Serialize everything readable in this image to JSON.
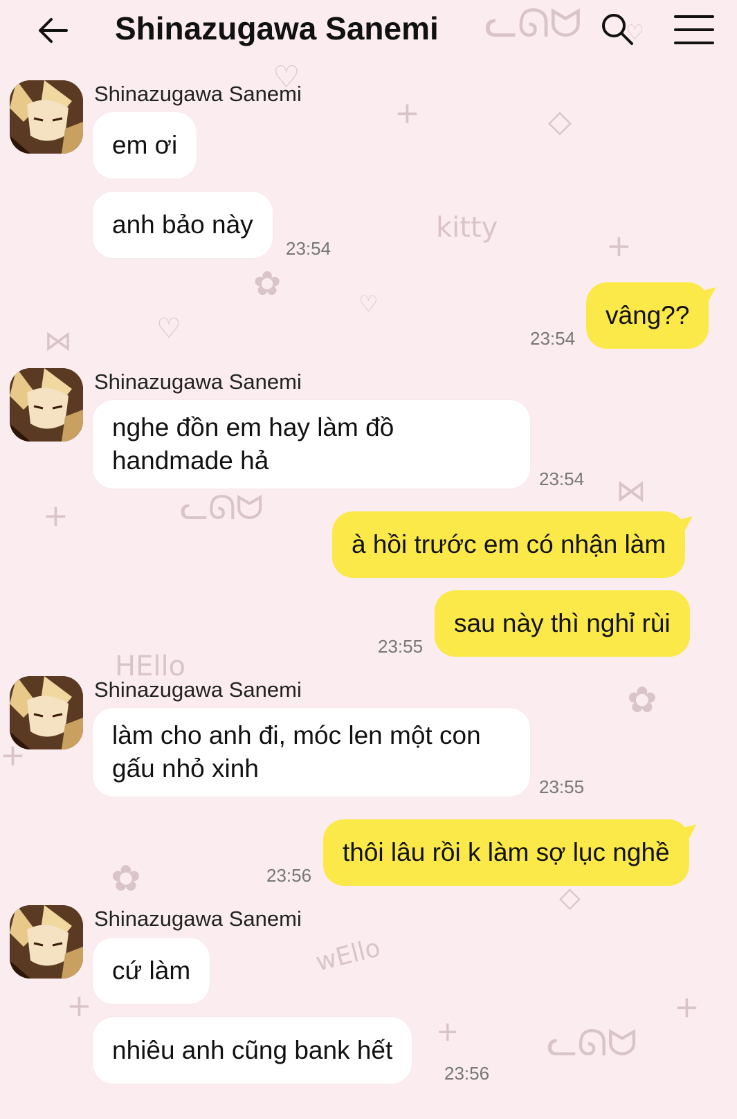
{
  "header": {
    "title": "Shinazugawa Sanemi"
  },
  "messages": [
    {
      "dir": "in",
      "sender": "Shinazugawa Sanemi",
      "text": "em ơi"
    },
    {
      "dir": "in",
      "text": "anh bảo này",
      "time": "23:54"
    },
    {
      "dir": "out",
      "text": "vâng??",
      "time": "23:54"
    },
    {
      "dir": "in",
      "sender": "Shinazugawa Sanemi",
      "text": "nghe đồn em hay làm đồ handmade hả",
      "time": "23:54"
    },
    {
      "dir": "out",
      "text": "à hồi trước em có nhận làm"
    },
    {
      "dir": "out",
      "text": "sau này thì nghỉ rùi",
      "time": "23:55"
    },
    {
      "dir": "in",
      "sender": "Shinazugawa Sanemi",
      "text": "làm cho anh đi, móc len một con gấu nhỏ xinh",
      "time": "23:55"
    },
    {
      "dir": "out",
      "text": "thôi lâu rồi k làm sợ lục nghề",
      "time": "23:56"
    },
    {
      "dir": "in",
      "sender": "Shinazugawa Sanemi",
      "text": "cứ làm"
    },
    {
      "dir": "in",
      "text": "nhiêu anh cũng bank hết",
      "time": "23:56"
    }
  ],
  "background_doodles": [
    "kitty",
    "HEllo",
    "wEllo"
  ],
  "colors": {
    "outgoing_bubble": "#fbe94a",
    "incoming_bubble": "#ffffff",
    "background": "#fbecef"
  }
}
